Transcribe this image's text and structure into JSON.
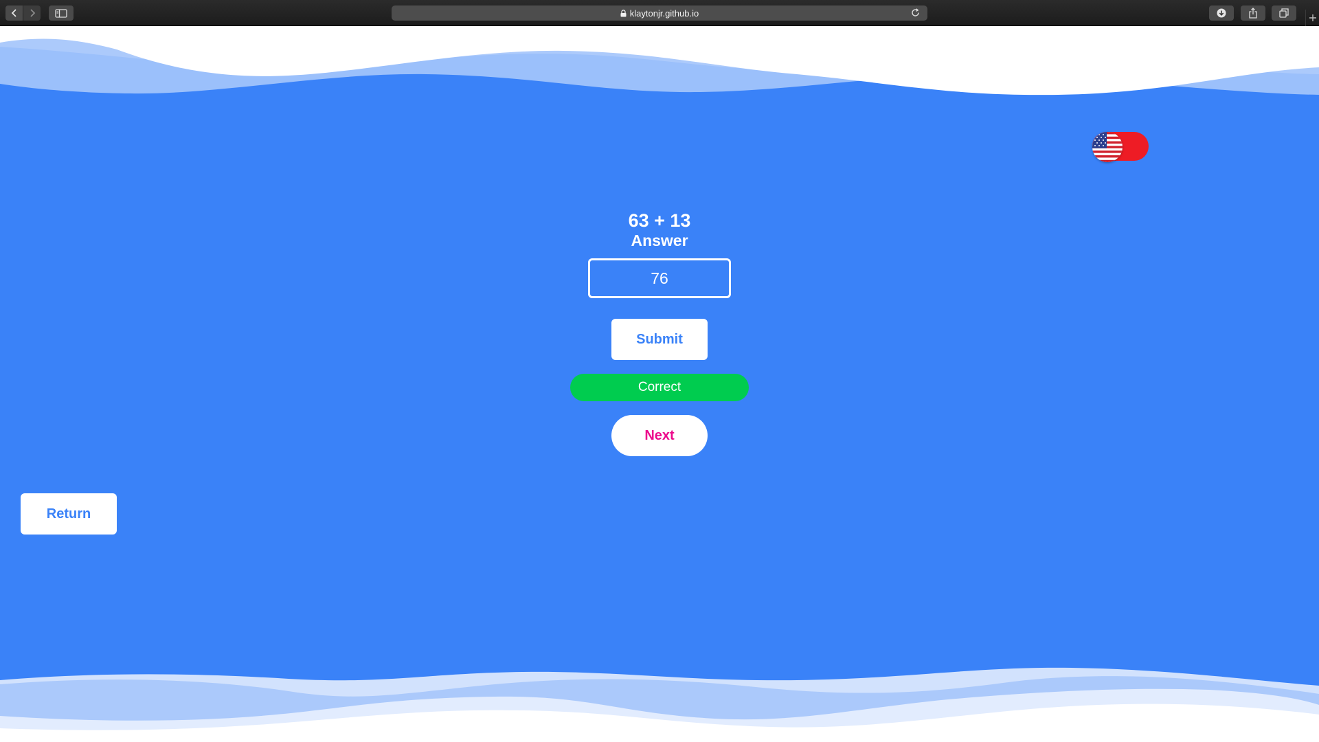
{
  "browser": {
    "url": "klaytonjr.github.io",
    "icons": {
      "back": "chevron-left-icon",
      "forward": "chevron-right-icon",
      "sidebar": "sidebar-icon",
      "lock": "lock-icon",
      "reload": "reload-icon",
      "download": "download-icon",
      "share": "share-icon",
      "tabs": "tabs-overview-icon",
      "new_tab": "plus-icon"
    }
  },
  "language_toggle": {
    "flag": "us-flag-icon",
    "toggle_color": "#ee1c25"
  },
  "quiz": {
    "question": "63 + 13",
    "answer_label": "Answer",
    "answer_value": "76",
    "submit_label": "Submit",
    "result_text": "Correct",
    "next_label": "Next"
  },
  "navigation": {
    "return_label": "Return"
  },
  "colors": {
    "background": "#3a82f8",
    "correct": "#00cc4f",
    "next_text": "#ec0a8c",
    "wave_light": "#a6c6fb"
  }
}
